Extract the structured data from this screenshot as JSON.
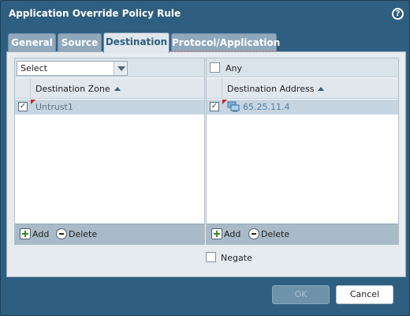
{
  "dialog": {
    "title": "Application Override Policy Rule",
    "help_icon": "question-circle-icon"
  },
  "tabs": [
    {
      "label": "General",
      "active": false
    },
    {
      "label": "Source",
      "active": false
    },
    {
      "label": "Destination",
      "active": true
    },
    {
      "label": "Protocol/Application",
      "active": false
    }
  ],
  "left_panel": {
    "select_value": "Select",
    "column_header": "Destination Zone",
    "rows": [
      {
        "label": "Untrust1",
        "checked": true
      }
    ],
    "add_label": "Add",
    "delete_label": "Delete"
  },
  "right_panel": {
    "any_label": "Any",
    "any_checked": false,
    "column_header": "Destination Address",
    "rows": [
      {
        "label": "65.25.11.4",
        "checked": true,
        "icon": "network-address-icon"
      }
    ],
    "add_label": "Add",
    "delete_label": "Delete"
  },
  "negate": {
    "label": "Negate",
    "checked": false
  },
  "buttons": {
    "ok_label": "OK",
    "cancel_label": "Cancel"
  },
  "colors": {
    "dialog_bg": "#2f5f80",
    "panel_bg": "#e6ebef",
    "selected_row": "#c7d5e0",
    "footer_bar": "#a9bac8"
  }
}
